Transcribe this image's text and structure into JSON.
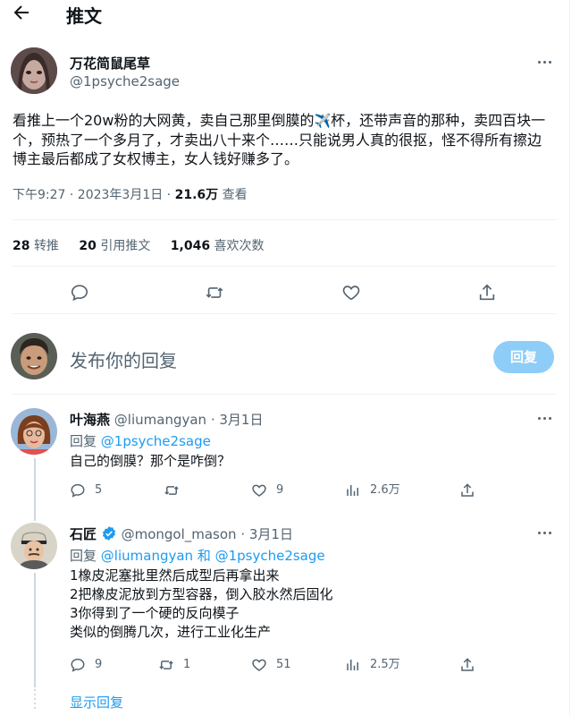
{
  "header": {
    "title": "推文"
  },
  "tweet": {
    "author_name": "万花简鼠尾草",
    "author_handle": "@1psyche2sage",
    "text_part1": "看推上一个20w粉的大网黄，卖自己那里倒膜的",
    "text_emoji": "✈️",
    "text_part2": "杯，还带声音的那种，卖四百块一个，预热了一个多月了，才卖出八十来个……只能说男人真的很抠，怪不得所有擦边博主最后都成了女权博主，女人钱好赚多了。",
    "time": "下午9:27 · 2023年3月1日",
    "views_count": "21.6万",
    "views_label": "查看",
    "stats": [
      {
        "count": "28",
        "label": "转推"
      },
      {
        "count": "20",
        "label": "引用推文"
      },
      {
        "count": "1,046",
        "label": "喜欢次数"
      }
    ]
  },
  "compose": {
    "placeholder": "发布你的回复",
    "button_label": "回复"
  },
  "replies": [
    {
      "name": "叶海燕",
      "handle": "@liumangyan",
      "date": "· 3月1日",
      "replying_prefix": "回复",
      "replying_to": "@1psyche2sage",
      "lines": [
        "自己的倒膜？那个是咋倒？"
      ],
      "replies": "5",
      "retweets": "",
      "likes": "9",
      "views": "2.6万"
    },
    {
      "name": "石匠",
      "handle": "@mongol_mason",
      "date": "· 3月1日",
      "replying_prefix": "回复",
      "replying_to": "@liumangyan 和 @1psyche2sage",
      "lines": [
        "1橡皮泥塞批里然后成型后再拿出来",
        "2把橡皮泥放到方型容器，倒入胶水然后固化",
        "3你得到了一个硬的反向模子",
        "类似的倒腾几次，进行工业化生产"
      ],
      "replies": "9",
      "retweets": "1",
      "likes": "51",
      "views": "2.5万"
    }
  ],
  "show_more": "显示回复",
  "colors": {
    "accent": "#1d9bf0",
    "muted": "#536471",
    "verified": "#1d9bf0"
  }
}
